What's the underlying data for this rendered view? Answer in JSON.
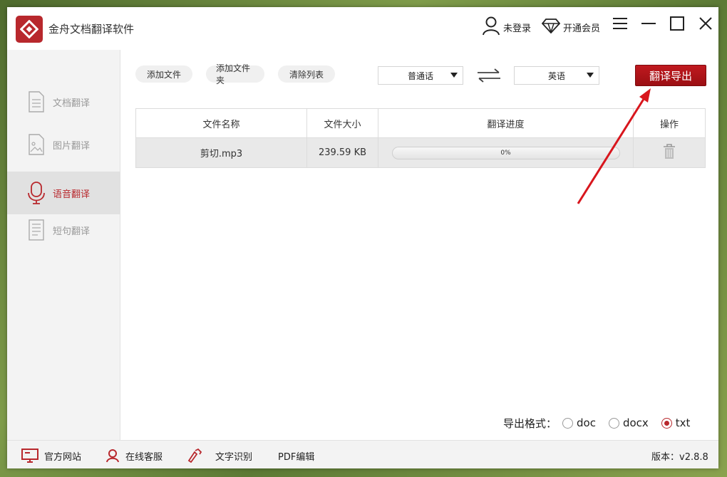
{
  "app": {
    "title": "金舟文档翻译软件"
  },
  "header": {
    "login_label": "未登录",
    "vip_label": "开通会员"
  },
  "sidebar": {
    "items": [
      {
        "label": "文档翻译",
        "icon": "document-icon"
      },
      {
        "label": "图片翻译",
        "icon": "image-icon"
      },
      {
        "label": "语音翻译",
        "icon": "microphone-icon",
        "active": true
      },
      {
        "label": "短句翻译",
        "icon": "text-page-icon"
      }
    ]
  },
  "toolbar": {
    "add_file_label": "添加文件",
    "add_folder_label": "添加文件夹",
    "clear_list_label": "清除列表",
    "source_lang": "普通话",
    "target_lang": "英语",
    "export_label": "翻译导出"
  },
  "table": {
    "headers": [
      "文件名称",
      "文件大小",
      "翻译进度",
      "操作"
    ],
    "rows": [
      {
        "name": "剪切.mp3",
        "size": "239.59 KB",
        "progress_text": "0%",
        "progress": 0
      }
    ]
  },
  "export_format": {
    "label": "导出格式：",
    "options": [
      "doc",
      "docx",
      "txt"
    ],
    "selected": "txt"
  },
  "footer": {
    "website_label": "官方网站",
    "support_label": "在线客服",
    "ocr_label": "文字识别",
    "pdf_label": "PDF编辑",
    "version": "版本：v2.8.8"
  },
  "colors": {
    "accent": "#b8282d"
  }
}
